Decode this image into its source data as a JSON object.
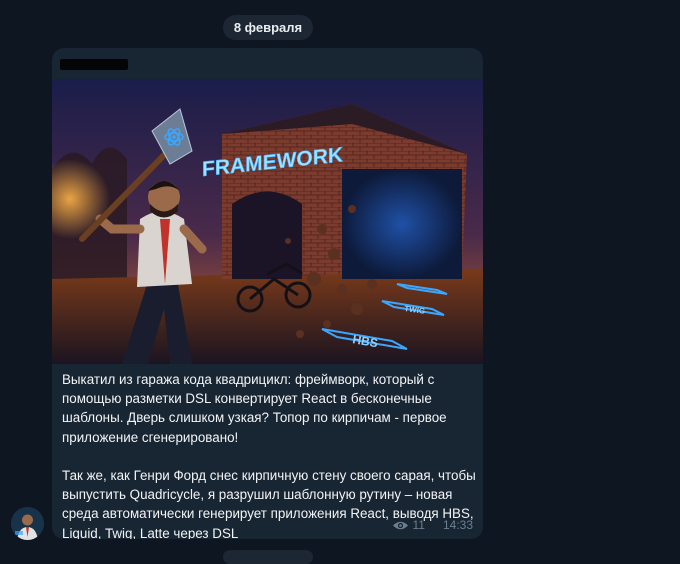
{
  "chat": {
    "date_label": "8 февраля"
  },
  "message": {
    "image": {
      "framework_label": "FRAMEWORK",
      "tiles": [
        "HBS",
        "TWIG"
      ]
    },
    "text": "Выкатил из гаража кода квадрицикл: фреймворк, который с помощью разметки DSL конвертирует React в бесконечные шаблоны. Дверь слишком узкая? Топор по кирпичам - первое приложение сгенерировано!\n\nТак же, как Генри Форд снес кирпичную стену своего сарая, чтобы выпустить Quadricycle, я разрушил шаблонную рутину – новая среда автоматически генерирует приложения React, выводя HBS, Liquid, Twig, Latte через DSL",
    "views": "11",
    "time": "14:33"
  },
  "colors": {
    "background": "#0e1621",
    "bubble": "#182533",
    "meta_text": "#6d7f8f",
    "neon": "#3aa7ff"
  },
  "icons": {
    "views": "eye-icon"
  }
}
